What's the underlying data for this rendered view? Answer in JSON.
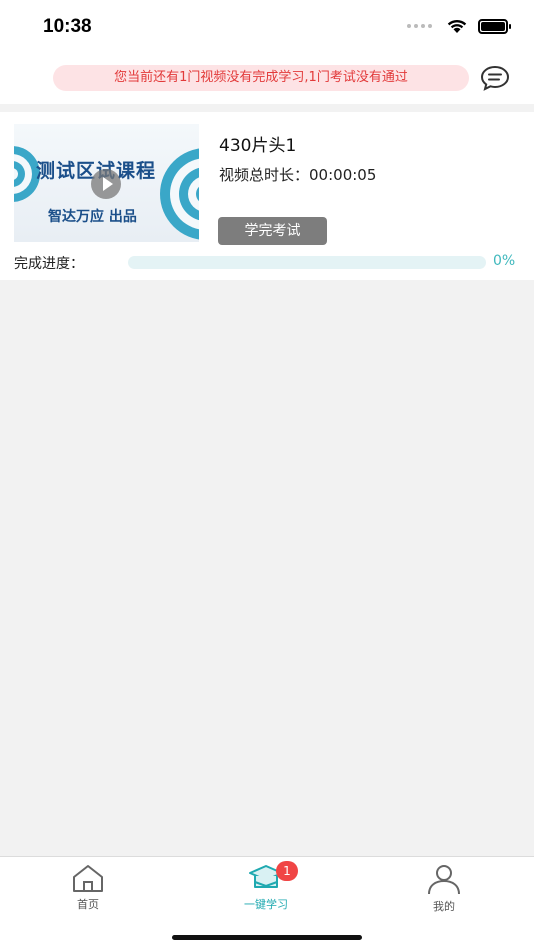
{
  "status_bar": {
    "time": "10:38"
  },
  "notice": {
    "text": "您当前还有1门视频没有完成学习,1门考试没有通过"
  },
  "course": {
    "thumbnail_title": "测试区试课程",
    "thumbnail_subtitle": "智达万应  出品",
    "title": "430片头1",
    "duration_label": "视频总时长：",
    "duration_value": "00:00:05",
    "exam_button": "学完考试",
    "progress_label": "完成进度：",
    "progress_value": "0%",
    "progress_fraction": 0
  },
  "tabs": [
    {
      "label": "首页",
      "icon": "home-icon",
      "active": false
    },
    {
      "label": "一键学习",
      "icon": "study-cap-icon",
      "active": true,
      "badge": "1"
    },
    {
      "label": "我的",
      "icon": "user-icon",
      "active": false
    }
  ],
  "colors": {
    "accent": "#3fb8bd",
    "notice_text": "#e23a3a",
    "notice_bg": "#fde3e5",
    "badge": "#f04545",
    "exam_button": "#7d7d7d"
  }
}
